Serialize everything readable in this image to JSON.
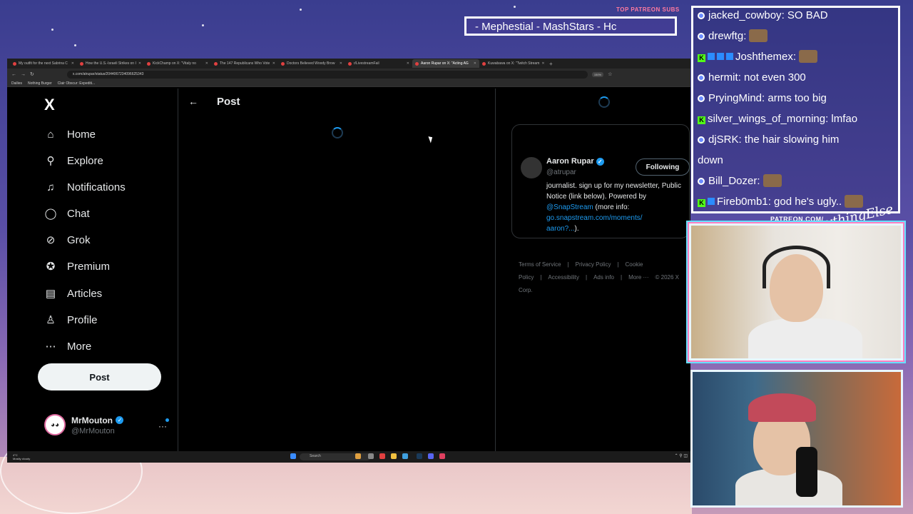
{
  "overlay": {
    "patreon_header": "TOP PATREON SUBS",
    "patreon_ticker": "- Mephestial - MashStars - Hc",
    "patreon_url": "PATREON.COM/",
    "brand_script": "AnythingElse"
  },
  "browser": {
    "tabs": [
      {
        "label": "My outfit for the next Sabrina C"
      },
      {
        "label": "How the U.S.-Israeli Strikes on I"
      },
      {
        "label": "KickChamp on X: \"Vitaly no"
      },
      {
        "label": "The 147 Republicans Who Vote"
      },
      {
        "label": "Doctors Believed Woody Brow"
      },
      {
        "label": "r/LivestreamFail"
      },
      {
        "label": "Aaron Rupar on X: \"Acting AG"
      },
      {
        "label": "Kuwabawa on X: \"Twitch Stream"
      }
    ],
    "url": "x.com/atrupar/status/2044067234096625343",
    "zoom": "150%",
    "bookmarks": [
      "Dailies",
      "Nothing Burger",
      "Clair Obscur: Expediti..."
    ]
  },
  "xnav": {
    "logo": "X",
    "items": [
      {
        "label": "Home",
        "icon": "home-icon",
        "glyph": "⌂"
      },
      {
        "label": "Explore",
        "icon": "search-icon",
        "glyph": "⚲"
      },
      {
        "label": "Notifications",
        "icon": "bell-icon",
        "glyph": "♫"
      },
      {
        "label": "Chat",
        "icon": "chat-icon",
        "glyph": "◯"
      },
      {
        "label": "Grok",
        "icon": "grok-icon",
        "glyph": "⊘"
      },
      {
        "label": "Premium",
        "icon": "premium-icon",
        "glyph": "✪"
      },
      {
        "label": "Articles",
        "icon": "articles-icon",
        "glyph": "▤"
      },
      {
        "label": "Profile",
        "icon": "profile-icon",
        "glyph": "♙"
      },
      {
        "label": "More",
        "icon": "more-icon",
        "glyph": "⋯"
      }
    ],
    "post_button": "Post",
    "account": {
      "name": "MrMouton",
      "handle": "@MrMouton"
    }
  },
  "main": {
    "header": "Post"
  },
  "profile_card": {
    "name": "Aaron Rupar",
    "handle": "@atrupar",
    "follow_label": "Following",
    "bio_text": "journalist. sign up for my newsletter, Public Notice (link below). Powered by",
    "bio_mention": "@SnapStream",
    "bio_more": "(more info:",
    "bio_link1": "go.snapstream.com/moments/",
    "bio_link2": "aaron?...",
    "bio_end": ")."
  },
  "footer": {
    "links": [
      "Terms of Service",
      "|",
      "Privacy Policy",
      "|",
      "Cookie Policy",
      "|",
      "Accessibility",
      "|",
      "Ads info",
      "|",
      "More ···",
      "© 2026 X Corp."
    ]
  },
  "taskbar": {
    "weather_temp": "4°C",
    "weather_desc": "Mostly cloudy",
    "search": "Search"
  },
  "chat": {
    "messages": [
      {
        "user": "jacked_cowboy",
        "text": ": SO BAD",
        "badges": [],
        "emote": false
      },
      {
        "user": "drewftg",
        "text": ":",
        "badges": [],
        "emote": true
      },
      {
        "user": "Joshthemex",
        "text": ":",
        "badges": [
          "kick",
          "sub",
          "sub",
          "sub"
        ],
        "emote": true
      },
      {
        "user": "hermit",
        "text": ": not even 300",
        "badges": [],
        "emote": false
      },
      {
        "user": "PryingMind",
        "text": ": arms too big",
        "badges": [],
        "emote": false
      },
      {
        "user": "silver_wings_of_morning",
        "text": ": lmfao",
        "badges": [
          "kick"
        ],
        "emote": false
      },
      {
        "user": "djSRK",
        "text": ": the hair slowing him",
        "badges": [],
        "emote": false
      },
      {
        "user": "",
        "text": "down",
        "badges": [],
        "emote": false
      },
      {
        "user": "Bill_Dozer",
        "text": ":",
        "badges": [],
        "emote": true
      },
      {
        "user": "Fireb0mb1",
        "text": ": god he's ugly..",
        "badges": [
          "kick",
          "sub"
        ],
        "emote": true
      }
    ]
  },
  "colors": {
    "x_blue": "#1d9bf0",
    "kick_green": "#53fc18",
    "x_bg": "#000000"
  }
}
